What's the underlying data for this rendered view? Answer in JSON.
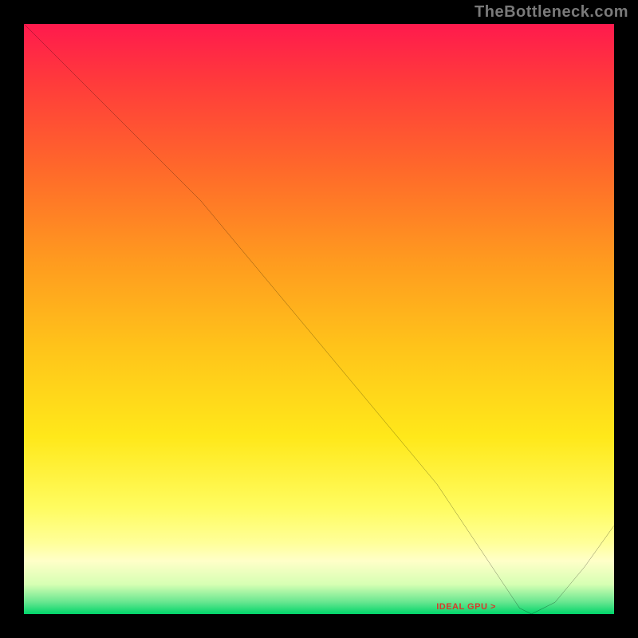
{
  "attribution": "TheBottleneck.com",
  "ideal_gpu_text": "IDEAL GPU >",
  "colors": {
    "bg": "#000000",
    "curve": "#000000",
    "ideal_text": "#d93a2b",
    "gradient_top": "#ff1a4d",
    "gradient_bottom": "#00d56a"
  },
  "chart_data": {
    "type": "line",
    "title": "",
    "xlabel": "",
    "ylabel": "",
    "xlim": [
      0,
      100
    ],
    "ylim": [
      0,
      100
    ],
    "grid": false,
    "legend": false,
    "series": [
      {
        "name": "bottleneck-curve",
        "x": [
          0,
          5,
          12,
          20,
          30,
          40,
          50,
          60,
          70,
          78,
          82,
          84,
          86,
          90,
          95,
          100
        ],
        "values": [
          100,
          95,
          88,
          80,
          70,
          58,
          46,
          34,
          22,
          10,
          4,
          1,
          0,
          2,
          8,
          15
        ]
      }
    ],
    "ideal_x": 84,
    "annotations": [
      {
        "text": "IDEAL GPU >",
        "x": 78,
        "y": 1
      }
    ]
  }
}
